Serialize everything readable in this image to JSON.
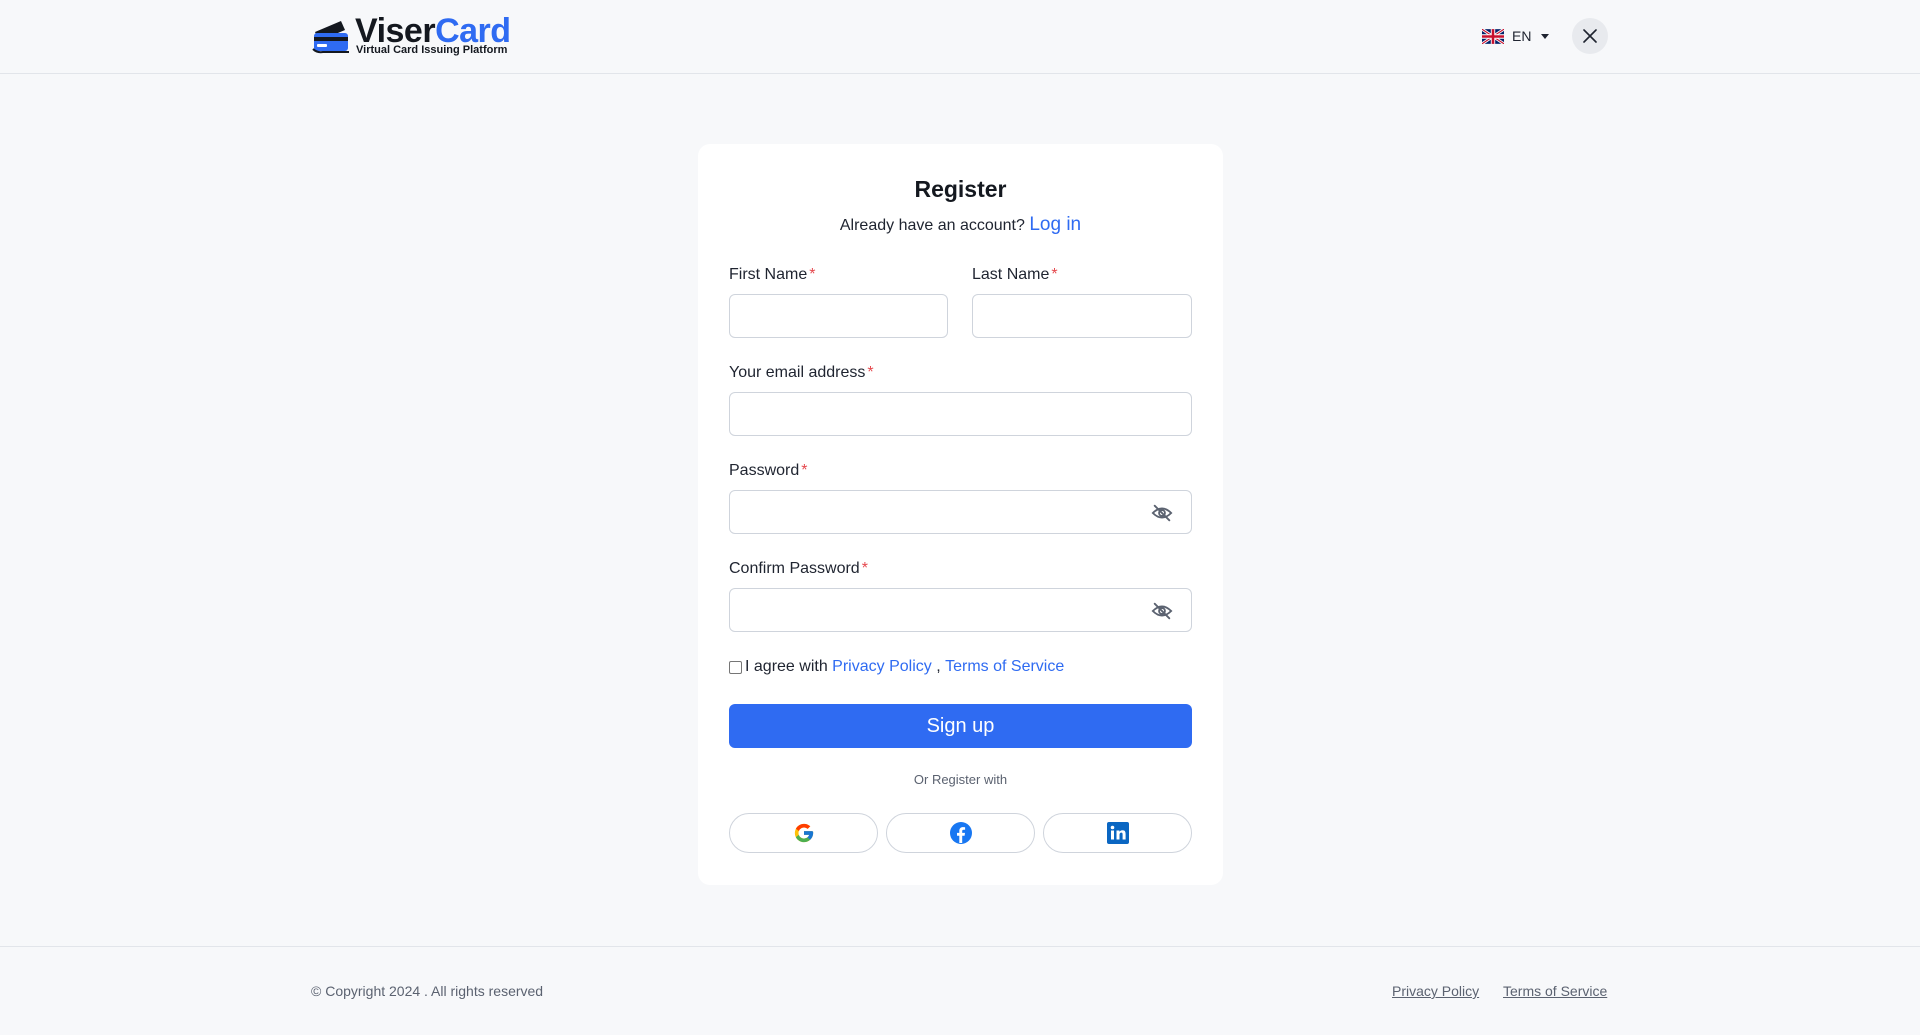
{
  "header": {
    "brand_part1": "Viser",
    "brand_part2": "Card",
    "tagline": "Virtual Card Issuing Platform",
    "language_code": "EN",
    "flag_icon": "uk-flag-icon",
    "close_icon": "close-icon"
  },
  "form": {
    "title": "Register",
    "subtitle_text": "Already have an account?",
    "login_link": "Log in",
    "required_mark": "*",
    "first_name_label": "First Name",
    "first_name_value": "",
    "last_name_label": "Last Name",
    "last_name_value": "",
    "email_label": "Your email address",
    "email_value": "",
    "password_label": "Password",
    "password_value": "",
    "confirm_password_label": "Confirm Password",
    "confirm_password_value": "",
    "eye_icon": "eye-slash-icon",
    "agree_text": "I agree with",
    "privacy_link": "Privacy Policy",
    "separator": ",",
    "terms_link": "Terms of Service",
    "agree_checked": false,
    "signup_label": "Sign up",
    "or_text": "Or Register with",
    "social": [
      "google-icon",
      "facebook-icon",
      "linkedin-icon"
    ]
  },
  "footer": {
    "copyright": "© Copyright 2024 . All rights reserved",
    "privacy": "Privacy Policy",
    "terms": "Terms of Service"
  },
  "colors": {
    "accent": "#2f6bf2",
    "required": "#e5484d",
    "page_bg": "#f7f8fa"
  }
}
